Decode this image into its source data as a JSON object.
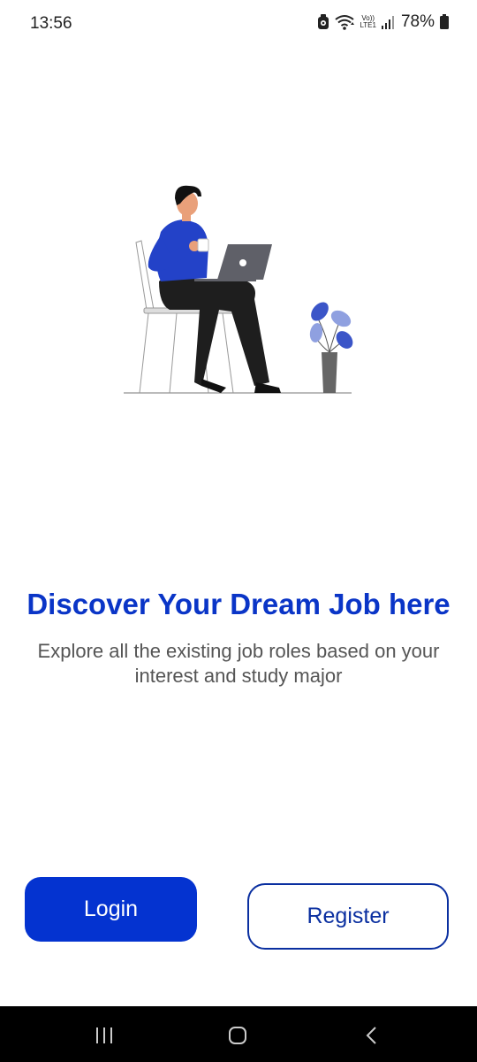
{
  "status_bar": {
    "time": "13:56",
    "volte_top": "Vo))",
    "volte_bottom": "LTE1",
    "battery_percent": "78%",
    "icons": [
      "android-auto-icon",
      "wifi-icon",
      "volte-icon",
      "signal-icon",
      "battery-icon"
    ]
  },
  "main": {
    "headline": "Discover Your Dream Job here",
    "subtext": "Explore all the existing job roles based on your interest and study major"
  },
  "buttons": {
    "login_label": "Login",
    "register_label": "Register"
  },
  "colors": {
    "accent": "#0433d0",
    "headline": "#0a35c7",
    "outline": "#0a2fa0",
    "subtext": "#555555"
  },
  "nav_bar": {
    "icons": [
      "recent-apps-icon",
      "home-icon",
      "back-icon"
    ]
  }
}
